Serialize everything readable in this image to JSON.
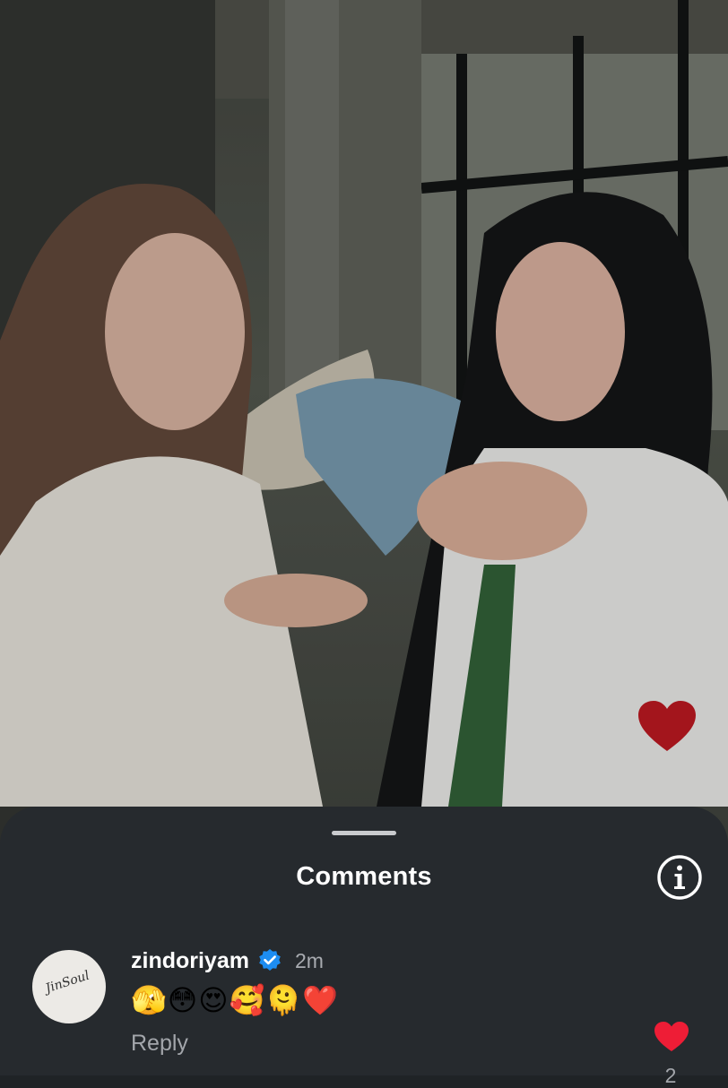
{
  "sheet": {
    "title": "Comments"
  },
  "comment": {
    "username": "zindoriyam",
    "time": "2m",
    "text": "🫣😳😍🥰🫠❤️",
    "reply_label": "Reply",
    "like_count": "2",
    "avatar_text": "JinSoul"
  },
  "icons": {
    "drag_handle": "drag-handle",
    "info": "info-icon",
    "verified": "verified-badge-icon",
    "like": "heart-icon",
    "floating_heart": "heart-icon"
  },
  "colors": {
    "sheet_bg": "#262a2e",
    "heart_red": "#ee1d36",
    "floating_heart": "#a3151c",
    "verified_blue": "#1d8df2",
    "muted_text": "#a3a6ab"
  }
}
